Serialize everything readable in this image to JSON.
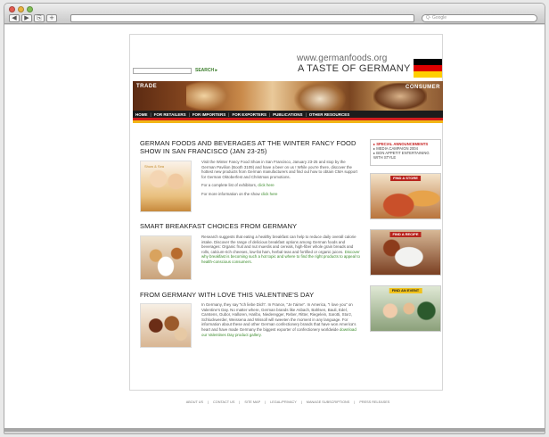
{
  "browser": {
    "nav_back": "◀",
    "nav_forward": "▶",
    "nav_share": "⎘",
    "nav_add": "+",
    "search_placeholder": "Q- Google"
  },
  "site": {
    "search_button": "SEARCH ▸",
    "url": "www.germanfoods.org",
    "tagline": "A TASTE OF GERMANY",
    "flag_colors": [
      "#000000",
      "#dd0000",
      "#ffce00"
    ],
    "banner": {
      "left_label": "TRADE",
      "right_label": "CONSUMER"
    },
    "nav": [
      "HOME",
      "FOR RETAILERS",
      "FOR IMPORTERS",
      "FOR EXPORTERS",
      "PUBLICATIONS",
      "OTHER RESOURCES"
    ]
  },
  "articles": [
    {
      "title": "GERMAN FOODS AND BEVERAGES AT THE WINTER FANCY FOOD SHOW IN SAN FRANCISCO (JAN 23-25)",
      "image_caption": "Show & Sea",
      "body": "Visit the Winter Fancy Food Show in San Francisco, January 23-25 and stop by the German Pavilion (Booth 3109) and have a beer on us ! While you're there, discover the hottest new products from German manufacturers and find out how to obtain CMA support for German Oktoberfest and Christmas promotions.",
      "p2_text": "For a complete list of exhibitors, ",
      "p2_link": "click here",
      "p3_text": "For more information on the show ",
      "p3_link": "click here"
    },
    {
      "title": "SMART BREAKFAST CHOICES FROM GERMANY",
      "body": "Research suggests that eating a healthy breakfast can help to reduce daily overall calorie intake. Discover the range of delicious breakfast options among German foods and beverages: Organic fruit and nut mueslis and cereals, high-fiber whole grain breads and rolls, calcium-rich cheeses, low-fat ham, herbal teas and fortified or organic juices. ",
      "link": "Discover why breakfast is becoming such a hot topic and where to find the right products to appeal to health-conscious consumers."
    },
    {
      "title": "FROM GERMANY WITH LOVE THIS VALENTINE'S DAY",
      "body": "In Germany, they say \"Ich liebe Dich\". In France, \"Je t'aime\". In America, \"I love you\" on Valentine's Day. No matter where, German brands like Asbach, Bahlsen, Bauli, Edel, Carstens, Gubor, Halloren, Haribo, Niederegger, Reber, Ritter, Riegelein, Sarotti, Storz, Schluckwerder, Weissena and Wissoll will sweeten the moment in any language. For information about these and other German confectionery brands that have won America's heart and have made Germany the biggest exporter of confectionery worldwide ",
      "link": "download our Valentines Day product gallery."
    }
  ],
  "sidebar": {
    "announce_title": "▸ SPECIAL ANNOUNCEMENTS",
    "announce_items": [
      "▸ MEDIA CAMPAIGN 2004",
      "▸ BON APPETIT ENTERTAINING WITH STYLE"
    ],
    "promos": [
      "FIND A STORE",
      "FIND A RECIPE",
      "FIND AN EVENT"
    ]
  },
  "footer": [
    "ABOUT US",
    "|",
    "CONTACT US",
    "|",
    "SITE MAP",
    "|",
    "LEGAL/PRIVACY",
    "|",
    "MANAGE SUBSCRIPTIONS",
    "|",
    "PRESS RELEASES"
  ]
}
